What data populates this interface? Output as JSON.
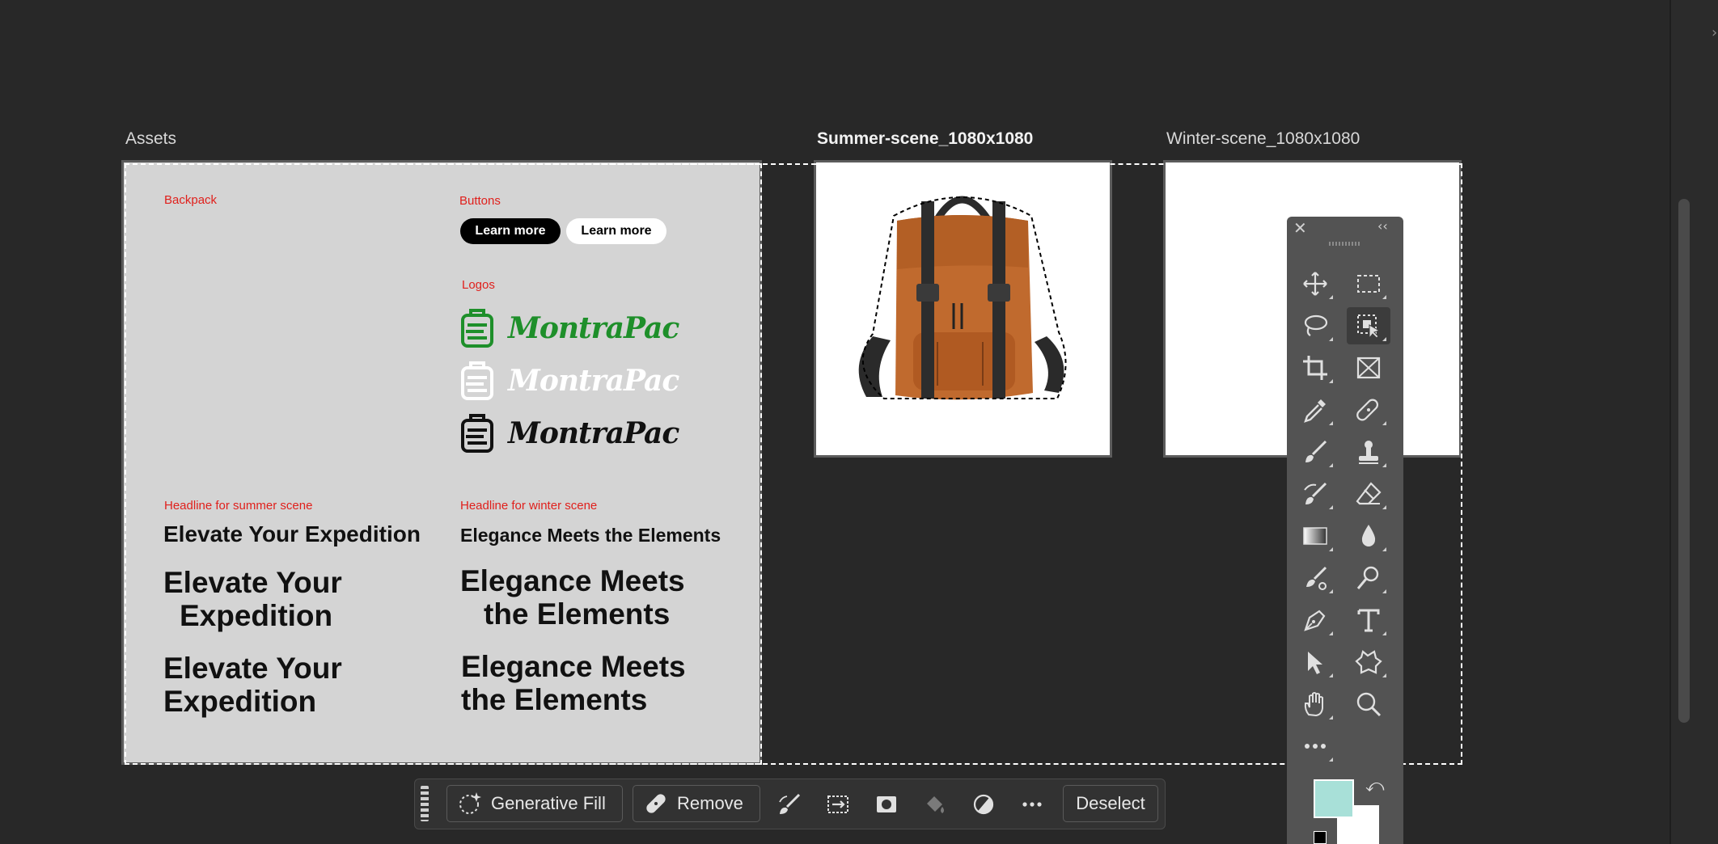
{
  "artboards": {
    "assets": {
      "label": "Assets"
    },
    "summer": {
      "label": "Summer-scene_1080x1080"
    },
    "winter": {
      "label": "Winter-scene_1080x1080"
    }
  },
  "assets_content": {
    "backpack_label": "Backpack",
    "buttons_label": "Buttons",
    "button_dark": "Learn more",
    "button_light": "Learn more",
    "logos_label": "Logos",
    "logo_text": "MontraPac",
    "logo_colors": [
      "#1e8f2a",
      "#ffffff",
      "#111111"
    ],
    "summer_headline_label": "Headline for summer scene",
    "winter_headline_label": "Headline for winter scene",
    "summer_h1": "Elevate Your Expedition",
    "summer_h2_line1": "Elevate Your",
    "summer_h2_line2": "Expedition",
    "summer_h3_line1": "Elevate Your",
    "summer_h3_line2": "Expedition",
    "winter_h1": "Elegance Meets the Elements",
    "winter_h2_line1": "Elegance Meets",
    "winter_h2_line2": "the Elements",
    "winter_h3_line1": "Elegance Meets",
    "winter_h3_line2": "the Elements"
  },
  "tool_panel": {
    "close_glyph": "✕",
    "collapse_glyph": "‹‹",
    "tools": [
      "move-tool",
      "rectangular-marquee-tool",
      "lasso-tool",
      "object-selection-tool",
      "crop-tool",
      "frame-tool",
      "eyedropper-tool",
      "spot-healing-brush-tool",
      "brush-tool",
      "clone-stamp-tool",
      "history-brush-tool",
      "eraser-tool",
      "gradient-tool",
      "blur-tool",
      "mixer-brush-tool",
      "dodge-tool",
      "pen-tool",
      "type-tool",
      "path-selection-tool",
      "shape-tool",
      "hand-tool",
      "zoom-tool",
      "more-tools"
    ],
    "foreground_color": "#a8e0d8",
    "background_color": "#ffffff"
  },
  "taskbar": {
    "generative_fill": "Generative Fill",
    "remove": "Remove",
    "deselect": "Deselect"
  }
}
